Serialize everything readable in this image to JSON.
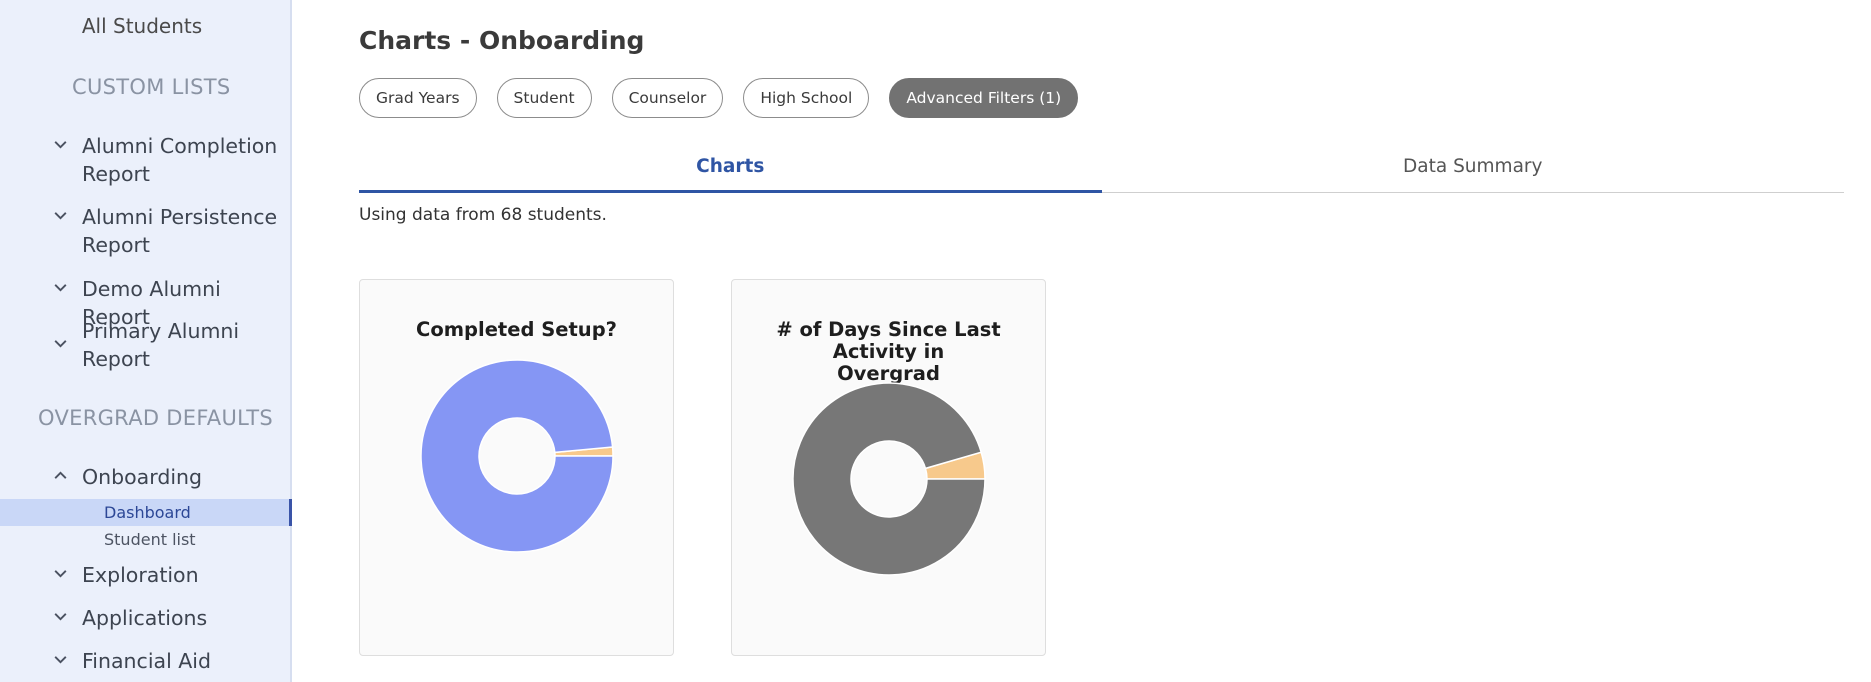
{
  "sidebar": {
    "all_students": "All Students",
    "custom_lists_heading": "CUSTOM LISTS",
    "custom_lists": [
      {
        "label_line1": "Alumni Completion",
        "label_line2": "Report"
      },
      {
        "label_line1": "Alumni Persistence",
        "label_line2": "Report"
      },
      {
        "label_line1": "Demo Alumni Report",
        "label_line2": ""
      },
      {
        "label_line1": "Primary Alumni",
        "label_line2": "Report"
      }
    ],
    "defaults_heading": "OVERGRAD DEFAULTS",
    "onboarding": {
      "label": "Onboarding",
      "children": [
        "Dashboard",
        "Student list"
      ],
      "active_child": "Dashboard"
    },
    "more_items": [
      "Exploration",
      "Applications",
      "Financial Aid"
    ]
  },
  "main": {
    "title": "Charts - Onboarding",
    "filters": [
      "Grad Years",
      "Student",
      "Counselor",
      "High School",
      "Advanced Filters (1)"
    ],
    "active_filter": "Advanced Filters (1)",
    "tabs": [
      "Charts",
      "Data Summary"
    ],
    "active_tab": "Charts",
    "using_text": "Using data from 68 students."
  },
  "chart_data": [
    {
      "type": "pie",
      "title": "Completed Setup?",
      "donut": true,
      "slices": [
        {
          "value": 98.5,
          "color": "#8596f4"
        },
        {
          "value": 1.5,
          "color": "#f7c98c"
        }
      ]
    },
    {
      "type": "pie",
      "title_line1": "# of Days Since Last Activity in",
      "title_line2": "Overgrad",
      "donut": true,
      "slices": [
        {
          "value": 95.5,
          "color": "#777777"
        },
        {
          "value": 4.5,
          "color": "#f7c98c"
        }
      ]
    }
  ]
}
